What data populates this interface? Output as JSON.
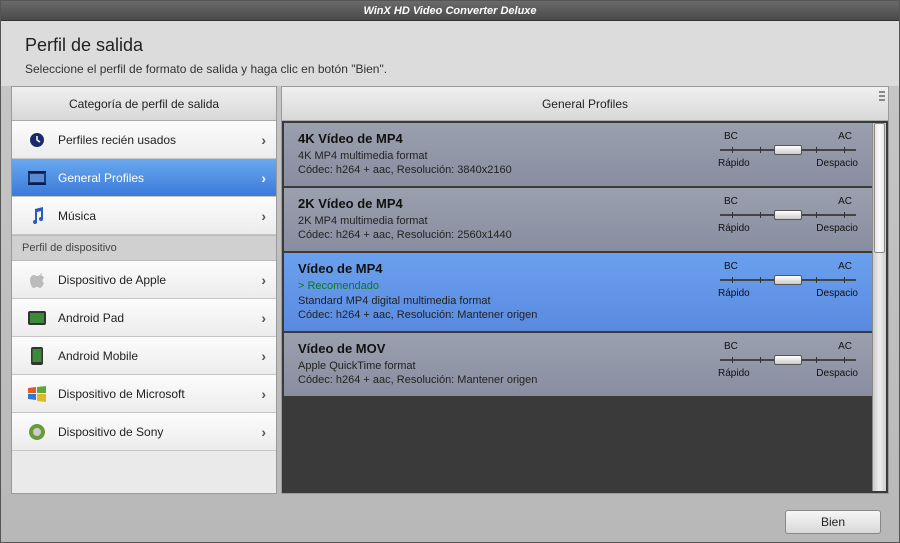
{
  "app_title": "WinX HD Video Converter Deluxe",
  "header": {
    "title": "Perfil de salida",
    "subtitle": "Seleccione el perfil de formato de salida y haga clic en botón \"Bien\"."
  },
  "sidebar": {
    "header": "Categoría de perfil de salida",
    "section_label": "Perfil de dispositivo",
    "items": [
      {
        "icon": "history-icon",
        "label": "Perfiles recién usados",
        "selected": false
      },
      {
        "icon": "film-icon",
        "label": "General Profiles",
        "selected": true
      },
      {
        "icon": "music-icon",
        "label": "Música",
        "selected": false
      }
    ],
    "device_items": [
      {
        "icon": "apple-icon",
        "label": "Dispositivo de Apple"
      },
      {
        "icon": "android-pad-icon",
        "label": "Android Pad"
      },
      {
        "icon": "android-mobile-icon",
        "label": "Android Mobile"
      },
      {
        "icon": "windows-icon",
        "label": "Dispositivo de Microsoft"
      },
      {
        "icon": "sony-icon",
        "label": "Dispositivo de Sony"
      }
    ]
  },
  "main": {
    "header": "General Profiles",
    "quality_labels": {
      "bc": "BC",
      "ac": "AC",
      "fast": "Rápido",
      "slow": "Despacio"
    },
    "profiles": [
      {
        "title": "4K Vídeo de MP4",
        "desc": "4K MP4 multimedia format",
        "codec": "Códec: h264 + aac, Resolución: 3840x2160",
        "recommended": "",
        "selected": false
      },
      {
        "title": "2K Vídeo de MP4",
        "desc": "2K MP4 multimedia format",
        "codec": "Códec: h264 + aac, Resolución: 2560x1440",
        "recommended": "",
        "selected": false
      },
      {
        "title": "Vídeo de MP4",
        "desc": "Standard MP4 digital multimedia format",
        "codec": "Códec: h264 + aac, Resolución: Mantener origen",
        "recommended": "> Recomendado",
        "selected": true
      },
      {
        "title": "Vídeo de MOV",
        "desc": "Apple QuickTime format",
        "codec": "Códec: h264 + aac, Resolución: Mantener origen",
        "recommended": "",
        "selected": false
      }
    ]
  },
  "footer": {
    "ok_label": "Bien"
  }
}
